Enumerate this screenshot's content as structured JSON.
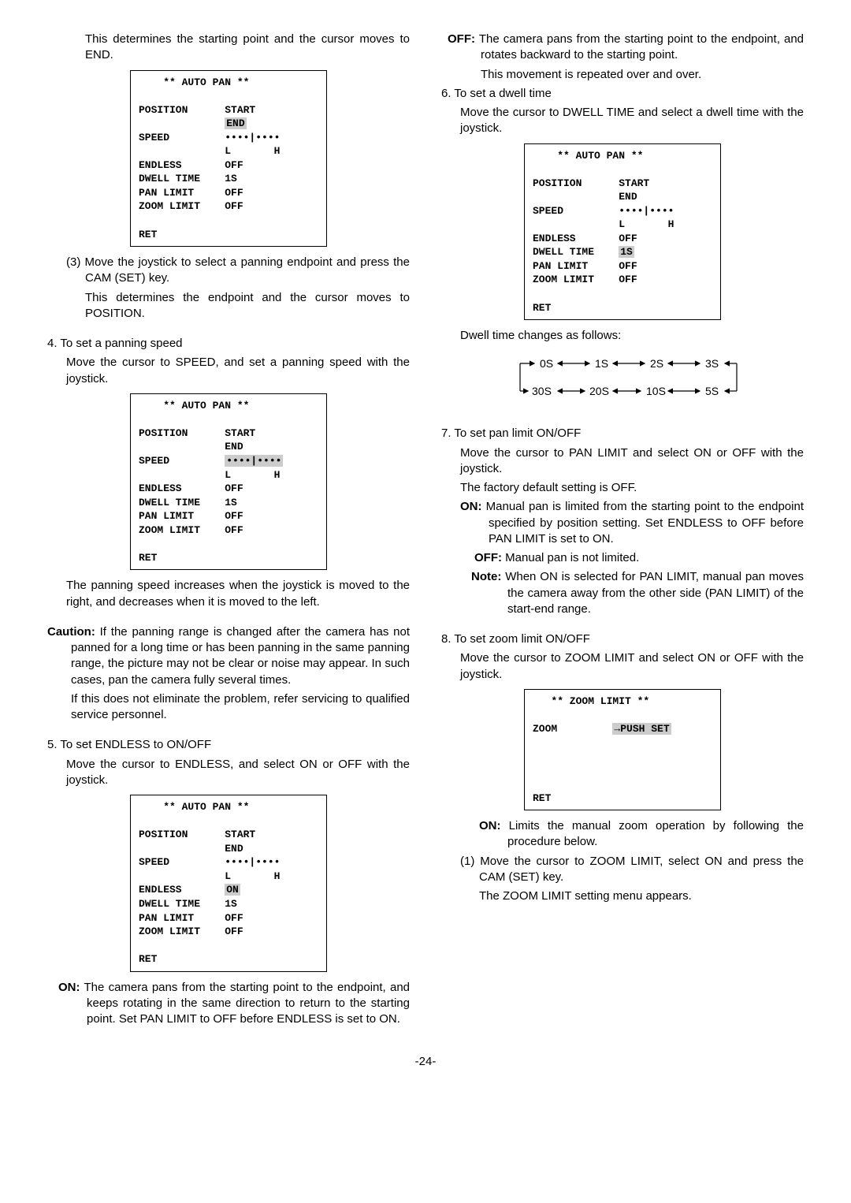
{
  "left": {
    "p1": "This determines the starting point and the cursor moves to END.",
    "menu1": {
      "title": "** AUTO PAN **",
      "rows": [
        [
          "POSITION",
          "START"
        ],
        [
          "",
          "END"
        ],
        [
          "SPEED",
          "••••|••••"
        ],
        [
          "",
          "L       H"
        ],
        [
          "ENDLESS",
          "OFF"
        ],
        [
          "DWELL TIME",
          "1S"
        ],
        [
          "PAN LIMIT",
          "OFF"
        ],
        [
          "ZOOM LIMIT",
          "OFF"
        ]
      ],
      "ret": "RET",
      "hilight": "END"
    },
    "step3a": "(3) Move the joystick to select a panning endpoint and press the CAM (SET) key.",
    "step3b": "This determines the endpoint and the cursor moves to POSITION.",
    "step4": "4. To set a panning speed",
    "step4a": "Move the cursor to SPEED, and set a panning speed with the joystick.",
    "menu2": {
      "title": "** AUTO PAN **",
      "rows": [
        [
          "POSITION",
          "START"
        ],
        [
          "",
          "END"
        ],
        [
          "SPEED",
          "••••|••••"
        ],
        [
          "",
          "L       H"
        ],
        [
          "ENDLESS",
          "OFF"
        ],
        [
          "DWELL TIME",
          "1S"
        ],
        [
          "PAN LIMIT",
          "OFF"
        ],
        [
          "ZOOM LIMIT",
          "OFF"
        ]
      ],
      "ret": "RET",
      "hilight_speed": true
    },
    "p_panning": "The panning speed increases when the joystick is moved to the right, and decreases when it is moved to the left.",
    "caution_label": "Caution:",
    "caution": " If the panning range is changed after the camera has not panned for a long time or has been panning in the same panning range, the picture may not be clear or noise may appear. In such cases, pan the camera fully several times.",
    "caution2": "If this does not eliminate the problem, refer servicing to qualified service personnel.",
    "step5": "5. To set ENDLESS to ON/OFF",
    "step5a": "Move the cursor to ENDLESS, and select ON or OFF with the joystick.",
    "menu3": {
      "title": "** AUTO PAN **",
      "rows": [
        [
          "POSITION",
          "START"
        ],
        [
          "",
          "END"
        ],
        [
          "SPEED",
          "••••|••••"
        ],
        [
          "",
          "L       H"
        ],
        [
          "ENDLESS",
          "ON"
        ],
        [
          "DWELL TIME",
          "1S"
        ],
        [
          "PAN LIMIT",
          "OFF"
        ],
        [
          "ZOOM LIMIT",
          "OFF"
        ]
      ],
      "ret": "RET",
      "hilight": "ON"
    },
    "on_label": "ON:",
    "on_text": " The camera pans from the starting point to the endpoint, and keeps rotating in the same direction to return to the starting point. Set PAN LIMIT to OFF before ENDLESS is set to ON."
  },
  "right": {
    "off_label": "OFF:",
    "off_text": " The camera pans from the starting point to the endpoint, and rotates backward to the starting point.",
    "off_text2": "This movement is repeated over and over.",
    "step6": "6. To set a dwell time",
    "step6a": "Move the cursor to DWELL TIME and select a dwell time with the joystick.",
    "menu4": {
      "title": "** AUTO PAN **",
      "rows": [
        [
          "POSITION",
          "START"
        ],
        [
          "",
          "END"
        ],
        [
          "SPEED",
          "••••|••••"
        ],
        [
          "",
          "L       H"
        ],
        [
          "ENDLESS",
          "OFF"
        ],
        [
          "DWELL TIME",
          "1S"
        ],
        [
          "PAN LIMIT",
          "OFF"
        ],
        [
          "ZOOM LIMIT",
          "OFF"
        ]
      ],
      "ret": "RET",
      "hilight": "1S"
    },
    "dwell_intro": "Dwell time changes as follows:",
    "dwell_values": [
      "0S",
      "1S",
      "2S",
      "3S",
      "5S",
      "10S",
      "20S",
      "30S"
    ],
    "step7": "7. To set pan limit ON/OFF",
    "step7a": "Move the cursor to PAN LIMIT and select ON or OFF with the joystick.",
    "step7b": "The factory default setting is OFF.",
    "on7_label": "ON:",
    "on7": " Manual pan is limited from the starting point to the endpoint specified by position setting. Set ENDLESS to OFF before PAN LIMIT is set to ON.",
    "off7_label": "OFF:",
    "off7": " Manual pan is not limited.",
    "note7_label": "Note:",
    "note7": " When ON is selected for PAN LIMIT, manual pan moves the camera away from the other side (PAN LIMIT) of the start-end range.",
    "step8": "8. To set zoom limit ON/OFF",
    "step8a": "Move the cursor to ZOOM LIMIT and select ON or OFF with the joystick.",
    "menu5": {
      "title": "** ZOOM LIMIT **",
      "zoom_label": "ZOOM",
      "push": "→PUSH SET",
      "ret": "RET"
    },
    "on8_label": "ON:",
    "on8": " Limits the manual zoom operation by following the procedure below.",
    "sub8_1": "(1) Move the cursor to ZOOM LIMIT, select ON and press the CAM (SET) key.",
    "sub8_1b": "The ZOOM LIMIT setting menu appears."
  },
  "footer": "-24-"
}
